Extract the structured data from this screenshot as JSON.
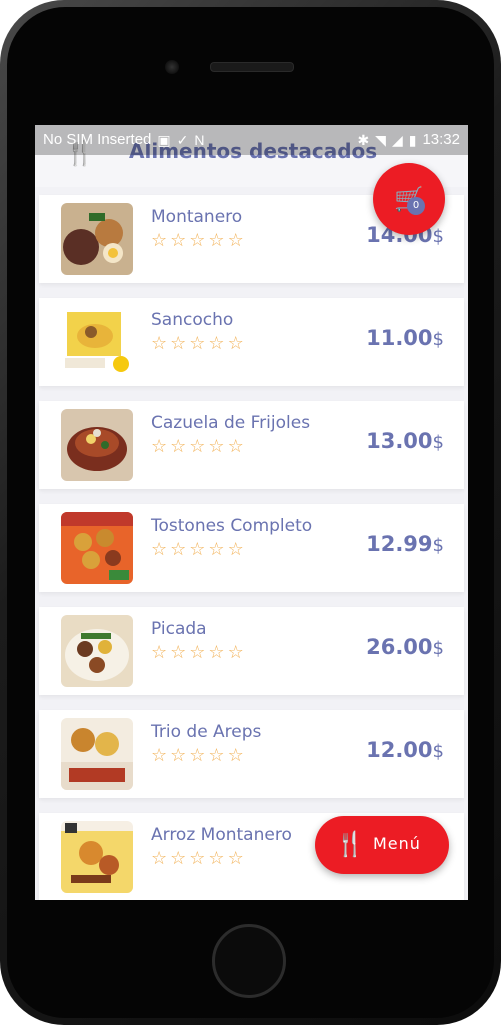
{
  "status_bar": {
    "carrier": "No SIM Inserted",
    "time": "13:32",
    "icons": [
      "image-icon",
      "check-circle-icon",
      "n-icon",
      "bluetooth-icon",
      "wifi-icon",
      "no-signal-icon",
      "battery-icon"
    ]
  },
  "header": {
    "title": "Alimentos destacados",
    "icon": "utensils-icon"
  },
  "cart": {
    "count": "0",
    "icon": "cart-icon"
  },
  "menu_button": {
    "label": "Menú",
    "icon": "utensils-icon"
  },
  "colors": {
    "accent": "#6a73b0",
    "brand_red": "#ec1c24",
    "star": "#f2b35a"
  },
  "items": [
    {
      "name": "Montanero",
      "price": "14.00",
      "currency": "$",
      "rating": 0
    },
    {
      "name": "Sancocho",
      "price": "11.00",
      "currency": "$",
      "rating": 0
    },
    {
      "name": "Cazuela de Frijoles",
      "price": "13.00",
      "currency": "$",
      "rating": 0
    },
    {
      "name": "Tostones Completo",
      "price": "12.99",
      "currency": "$",
      "rating": 0
    },
    {
      "name": "Picada",
      "price": "26.00",
      "currency": "$",
      "rating": 0
    },
    {
      "name": "Trio de Areps",
      "price": "12.00",
      "currency": "$",
      "rating": 0
    },
    {
      "name": "Arroz Montanero",
      "price": "",
      "currency": "",
      "rating": 0
    }
  ]
}
